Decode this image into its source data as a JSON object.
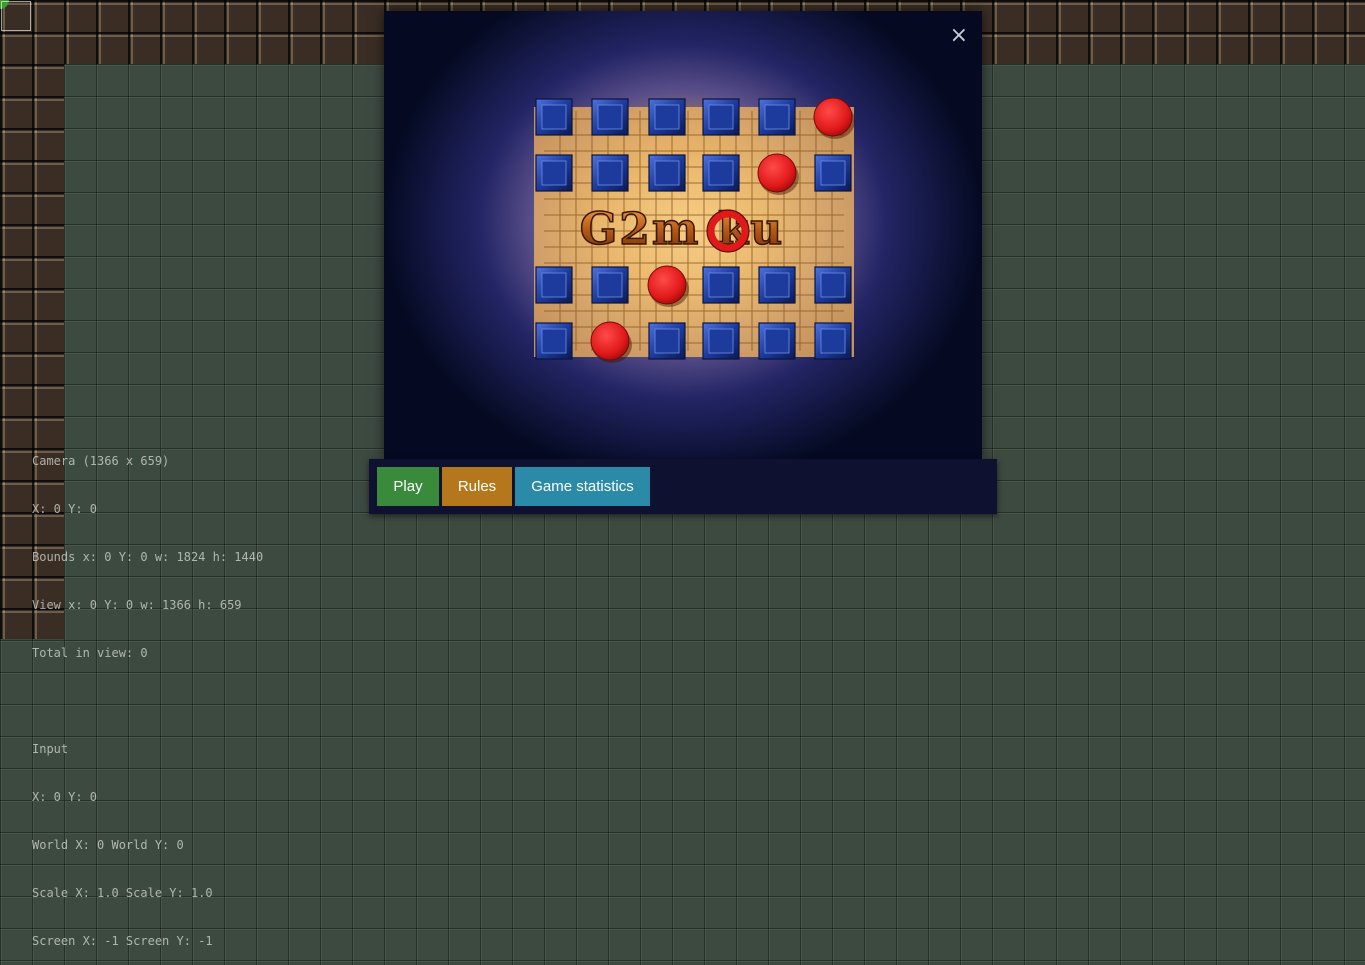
{
  "debug": {
    "camera": {
      "title": "Camera (1366 x 659)",
      "xy": "X: 0 Y: 0",
      "bounds": "Bounds x: 0 Y: 0 w: 1824 h: 1440",
      "view": "View x: 0 Y: 0 w: 1366 h: 659",
      "total": "Total in view: 0"
    },
    "input": {
      "title": "Input",
      "xy": "X: 0 Y: 0",
      "world": "World X: 0 World Y: 0",
      "scale": "Scale X: 1.0 Scale Y: 1.0",
      "screen": "Screen X: -1 Screen Y: -1"
    }
  },
  "modal": {
    "close_label": "×",
    "logo_text": "G2m ku",
    "buttons": {
      "play": "Play",
      "rules": "Rules",
      "stats": "Game statistics"
    }
  },
  "colors": {
    "play": "#3a8a3c",
    "rules": "#b5771c",
    "stats": "#2b8aa8",
    "stone_red": "#e01919",
    "tile_blue": "#1d3b9c"
  },
  "board": {
    "rows": [
      [
        "blue",
        "blue",
        "blue",
        "blue",
        "blue",
        "red"
      ],
      [
        "blue",
        "blue",
        "blue",
        "blue",
        "red",
        "blue"
      ],
      [
        "blue",
        "blue",
        "red",
        "blue",
        "blue",
        "blue"
      ],
      [
        "blue",
        "red",
        "blue",
        "blue",
        "blue",
        "blue"
      ]
    ]
  }
}
